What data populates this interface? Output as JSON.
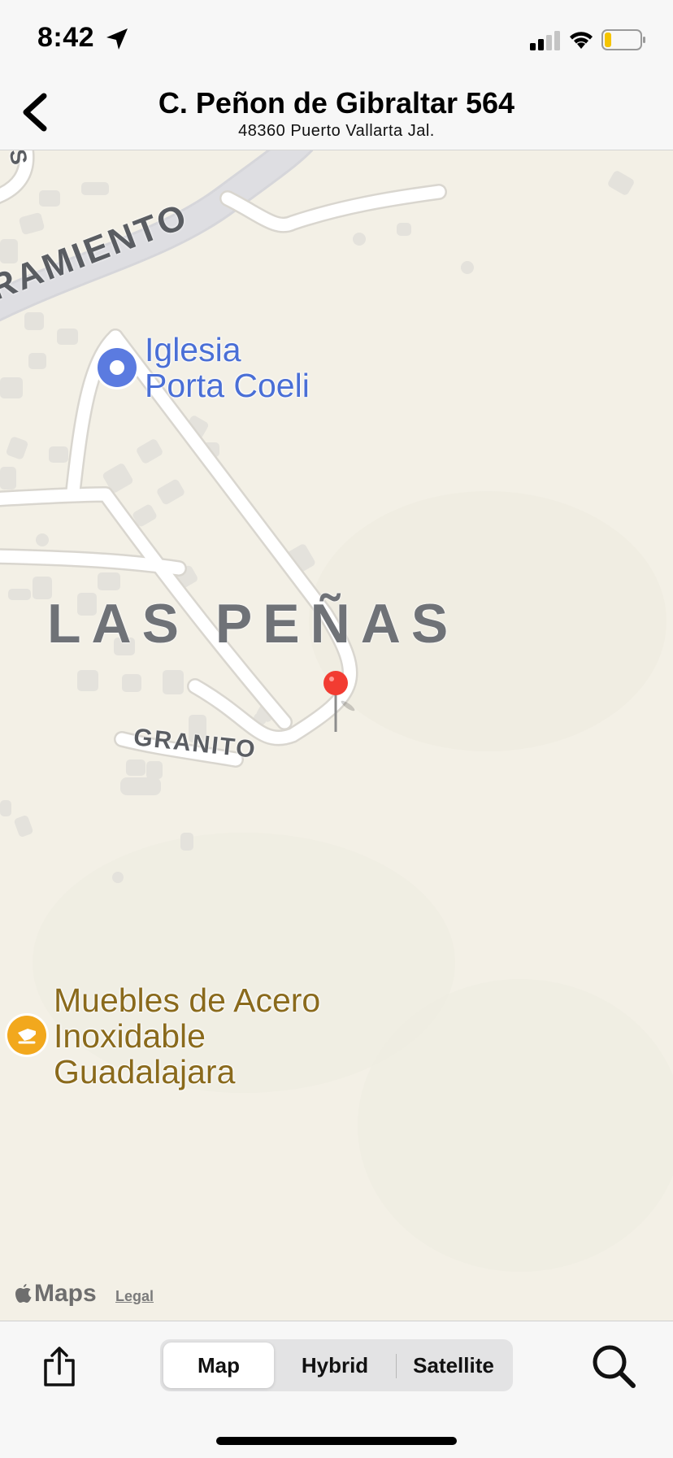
{
  "status_bar": {
    "time": "8:42",
    "location_icon": "location-arrow-icon",
    "signal_icon": "cellular-signal-icon",
    "wifi_icon": "wifi-icon",
    "battery_icon": "battery-low-icon",
    "battery_color": "#f5c400"
  },
  "header": {
    "back_icon": "chevron-left-icon",
    "title": "C. Peñon de Gibraltar 564",
    "subtitle": "48360 Puerto Vallarta Jal."
  },
  "map": {
    "poi_church": {
      "line1": "Iglesia",
      "line2": "Porta Coeli",
      "icon": "place-of-worship-icon",
      "color": "#5b7be0"
    },
    "neighborhood": "LAS PEÑAS",
    "street_granito": "GRANITO",
    "street_sacramento": "RAMIENTO",
    "street_s": "S",
    "poi_store": {
      "line1": "Muebles de Acero",
      "line2": "Inoxidable",
      "line3": "Guadalajara",
      "icon": "shopping-bag-icon",
      "color": "#f2a81d"
    },
    "pin": {
      "icon": "red-pin-icon",
      "color": "#f23c32"
    },
    "attribution": "Maps",
    "legal": "Legal"
  },
  "toolbar": {
    "share_icon": "share-icon",
    "segments": [
      "Map",
      "Hybrid",
      "Satellite"
    ],
    "selected_segment": "Map",
    "search_icon": "search-icon"
  }
}
